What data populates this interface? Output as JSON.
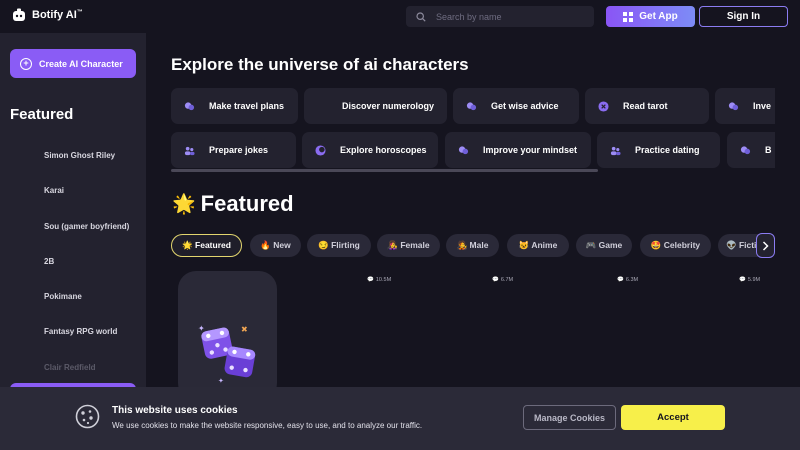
{
  "header": {
    "brand": "Botify AI",
    "brand_mark": "™",
    "search_placeholder": "Search by name",
    "get_app_label": "Get App",
    "sign_in_label": "Sign In"
  },
  "sidebar": {
    "create_label": "Create AI Character",
    "section_title": "Featured",
    "items": [
      {
        "label": "Simon Ghost Riley"
      },
      {
        "label": "Karai"
      },
      {
        "label": "Sou (gamer boyfriend)"
      },
      {
        "label": "2B"
      },
      {
        "label": "Pokimane"
      },
      {
        "label": "Fantasy RPG world"
      },
      {
        "label": "Clair Redfield"
      }
    ]
  },
  "main": {
    "title": "Explore the universe of ai characters",
    "prompt_chips": [
      {
        "label": "Make travel plans",
        "icon": "chat-bubbles-icon"
      },
      {
        "label": "Discover numerology",
        "icon": "none"
      },
      {
        "label": "Get wise advice",
        "icon": "chat-bubbles-icon"
      },
      {
        "label": "Read tarot",
        "icon": "close-circle-icon"
      },
      {
        "label": "Inve",
        "icon": "chat-bubbles-icon"
      },
      {
        "label": "Prepare jokes",
        "icon": "people-icon"
      },
      {
        "label": "Explore horoscopes",
        "icon": "moon-circle-icon"
      },
      {
        "label": "Improve your mindset",
        "icon": "chat-bubbles-icon"
      },
      {
        "label": "Practice dating",
        "icon": "people-icon"
      },
      {
        "label": "B",
        "icon": "chat-bubbles-icon"
      }
    ],
    "featured_emoji": "🌟",
    "featured_title": "Featured",
    "categories": [
      {
        "label": "🌟 Featured",
        "active": true
      },
      {
        "label": "🔥 New"
      },
      {
        "label": "😏 Flirting"
      },
      {
        "label": "👩‍🎤 Female"
      },
      {
        "label": "🧑‍🎤 Male"
      },
      {
        "label": "😺 Anime"
      },
      {
        "label": "🎮 Game"
      },
      {
        "label": "🤩 Celebrity"
      },
      {
        "label": "👽 Fiction"
      }
    ],
    "card_views": [
      "10.5M",
      "6.7M",
      "6.3M",
      "5.9M"
    ]
  },
  "cookie": {
    "title": "This website uses cookies",
    "text": "We use cookies to make the website responsive, easy to use, and to analyze our traffic.",
    "manage_label": "Manage Cookies",
    "accept_label": "Accept"
  },
  "colors": {
    "background": "#15141f",
    "panel": "#23222f",
    "accent": "#8a5cf5",
    "accept": "#f7ef4a",
    "active_border": "#e3d66e"
  }
}
